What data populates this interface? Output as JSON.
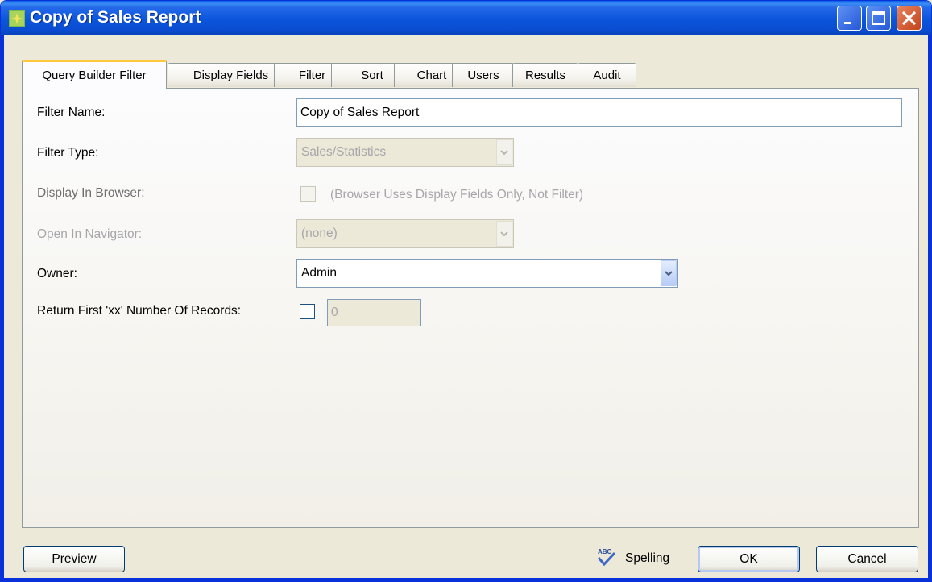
{
  "window": {
    "title": "Copy of Sales Report"
  },
  "tabs": [
    {
      "label": "Query Builder Filter",
      "active": true
    },
    {
      "label": "Display Fields"
    },
    {
      "label": "Filter"
    },
    {
      "label": "Sort"
    },
    {
      "label": "Chart"
    },
    {
      "label": "Users"
    },
    {
      "label": "Results"
    },
    {
      "label": "Audit"
    }
  ],
  "form": {
    "filter_name_label": "Filter Name:",
    "filter_name_value": "Copy of Sales Report",
    "filter_type_label": "Filter Type:",
    "filter_type_value": "Sales/Statistics",
    "display_in_browser_label": "Display In Browser:",
    "display_in_browser_note": "(Browser Uses Display Fields Only, Not Filter)",
    "open_in_navigator_label": "Open In Navigator:",
    "open_in_navigator_value": "(none)",
    "owner_label": "Owner:",
    "owner_value": "Admin",
    "return_first_label": "Return First 'xx' Number Of Records:",
    "return_first_value": "0"
  },
  "footer": {
    "preview_label": "Preview",
    "spelling_label": "Spelling",
    "spelling_icon_text": "ABC",
    "ok_label": "OK",
    "cancel_label": "Cancel"
  },
  "icons": {
    "app": "app-icon",
    "minimize": "minimize-icon",
    "maximize": "maximize-icon",
    "close": "close-icon",
    "dropdown": "chevron-down-icon",
    "spelling": "spellcheck-icon"
  },
  "colors": {
    "titlebar": "#0A55DC",
    "window_bg": "#ECE9D8",
    "active_tab_accent": "#FFC83C",
    "disabled_text": "#A7A6AA"
  }
}
